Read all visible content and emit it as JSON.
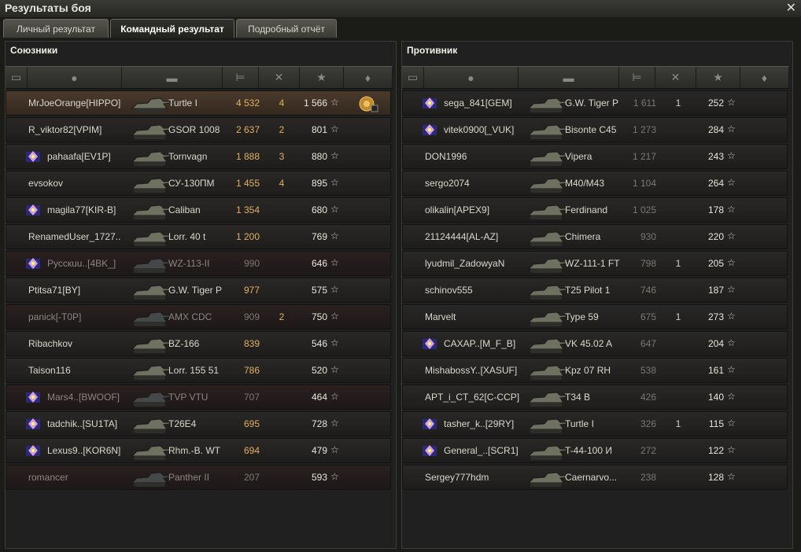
{
  "window": {
    "title": "Результаты боя"
  },
  "tabs": [
    {
      "label": "Личный результат",
      "active": false
    },
    {
      "label": "Командный результат",
      "active": true
    },
    {
      "label": "Подробный отчёт",
      "active": false
    }
  ],
  "headers": {
    "icons": [
      "platoon-icon",
      "player-icon",
      "tank-icon",
      "damage-icon",
      "frags-icon",
      "xp-icon",
      "medal-icon"
    ]
  },
  "allies": {
    "title": "Союзники",
    "rows": [
      {
        "name": "MrJoeOrange[HIPPO]",
        "badge": false,
        "vehicle": "Turtle I",
        "damage": "4 532",
        "frags": "4",
        "xp": "1 566",
        "medal": true,
        "style": "first"
      },
      {
        "name": "R_viktor82[VPIM]",
        "badge": false,
        "vehicle": "GSOR 1008",
        "damage": "2 637",
        "frags": "2",
        "xp": "801",
        "medal": false,
        "style": ""
      },
      {
        "name": "pahaafa[EV1P]",
        "badge": true,
        "vehicle": "Tornvagn",
        "damage": "1 888",
        "frags": "3",
        "xp": "880",
        "medal": false,
        "style": ""
      },
      {
        "name": "evsokov",
        "badge": false,
        "vehicle": "СУ-130ПМ",
        "damage": "1 455",
        "frags": "4",
        "xp": "895",
        "medal": false,
        "style": ""
      },
      {
        "name": "magila77[KIR-B]",
        "badge": true,
        "vehicle": "Caliban",
        "damage": "1 354",
        "frags": "",
        "xp": "680",
        "medal": false,
        "style": ""
      },
      {
        "name": "RenamedUser_1727..",
        "badge": false,
        "vehicle": "Lorr. 40 t",
        "damage": "1 200",
        "frags": "",
        "xp": "769",
        "medal": false,
        "style": ""
      },
      {
        "name": "Pусскuu..[4BK_]",
        "badge": true,
        "vehicle": "WZ-113-II",
        "damage": "990",
        "frags": "",
        "xp": "646",
        "medal": false,
        "style": "dead"
      },
      {
        "name": "Ptitsa71[BY]",
        "badge": false,
        "vehicle": "G.W. Tiger P",
        "damage": "977",
        "frags": "",
        "xp": "575",
        "medal": false,
        "style": ""
      },
      {
        "name": "panick[-T0P]",
        "badge": false,
        "vehicle": "AMX CDC",
        "damage": "909",
        "frags": "2",
        "xp": "750",
        "medal": false,
        "style": "dead"
      },
      {
        "name": "Ribachkov",
        "badge": false,
        "vehicle": "BZ-166",
        "damage": "839",
        "frags": "",
        "xp": "546",
        "medal": false,
        "style": ""
      },
      {
        "name": "Taison116",
        "badge": false,
        "vehicle": "Lorr. 155 51",
        "damage": "786",
        "frags": "",
        "xp": "520",
        "medal": false,
        "style": ""
      },
      {
        "name": "Mars4..[BWOOF]",
        "badge": true,
        "vehicle": "TVP VTU",
        "damage": "707",
        "frags": "",
        "xp": "464",
        "medal": false,
        "style": "dead"
      },
      {
        "name": "tadchik..[SU1TA]",
        "badge": true,
        "vehicle": "T26E4",
        "damage": "695",
        "frags": "",
        "xp": "728",
        "medal": false,
        "style": ""
      },
      {
        "name": "Lexus9..[KOR6N]",
        "badge": true,
        "vehicle": "Rhm.-B. WT",
        "damage": "694",
        "frags": "",
        "xp": "479",
        "medal": false,
        "style": ""
      },
      {
        "name": "romancer",
        "badge": false,
        "vehicle": "Panther II",
        "damage": "207",
        "frags": "",
        "xp": "593",
        "medal": false,
        "style": "dead"
      }
    ]
  },
  "enemies": {
    "title": "Противник",
    "rows": [
      {
        "name": "sega_841[GEM]",
        "badge": true,
        "vehicle": "G.W. Tiger P",
        "damage": "1 611",
        "frags": "1",
        "xp": "252",
        "medal": false,
        "style": ""
      },
      {
        "name": "vitek0900[_VUK]",
        "badge": true,
        "vehicle": "Bisonte C45",
        "damage": "1 273",
        "frags": "",
        "xp": "284",
        "medal": false,
        "style": ""
      },
      {
        "name": "DON1996",
        "badge": false,
        "vehicle": "Vipera",
        "damage": "1 217",
        "frags": "",
        "xp": "243",
        "medal": false,
        "style": ""
      },
      {
        "name": "sergo2074",
        "badge": false,
        "vehicle": "M40/M43",
        "damage": "1 104",
        "frags": "",
        "xp": "264",
        "medal": false,
        "style": ""
      },
      {
        "name": "olikalin[APEX9]",
        "badge": false,
        "vehicle": "Ferdinand",
        "damage": "1 025",
        "frags": "",
        "xp": "178",
        "medal": false,
        "style": ""
      },
      {
        "name": "21124444[AL-AZ]",
        "badge": false,
        "vehicle": "Chimera",
        "damage": "930",
        "frags": "",
        "xp": "220",
        "medal": false,
        "style": ""
      },
      {
        "name": "lyudmil_ZadowyaN",
        "badge": false,
        "vehicle": "WZ-111-1 FT",
        "damage": "798",
        "frags": "1",
        "xp": "205",
        "medal": false,
        "style": ""
      },
      {
        "name": "schinov555",
        "badge": false,
        "vehicle": "T25 Pilot 1",
        "damage": "746",
        "frags": "",
        "xp": "187",
        "medal": false,
        "style": ""
      },
      {
        "name": "Marvelt",
        "badge": false,
        "vehicle": "Type 59",
        "damage": "675",
        "frags": "1",
        "xp": "273",
        "medal": false,
        "style": ""
      },
      {
        "name": "CAXAP..[M_F_B]",
        "badge": true,
        "vehicle": "VK 45.02 A",
        "damage": "647",
        "frags": "",
        "xp": "204",
        "medal": false,
        "style": ""
      },
      {
        "name": "MishabossY..[XASUF]",
        "badge": false,
        "vehicle": "Kpz 07 RH",
        "damage": "538",
        "frags": "",
        "xp": "161",
        "medal": false,
        "style": ""
      },
      {
        "name": "APT_i_CT_62[C-CCP]",
        "badge": false,
        "vehicle": "T34 B",
        "damage": "426",
        "frags": "",
        "xp": "140",
        "medal": false,
        "style": ""
      },
      {
        "name": "tasher_k..[29RY]",
        "badge": true,
        "vehicle": "Turtle I",
        "damage": "326",
        "frags": "1",
        "xp": "115",
        "medal": false,
        "style": ""
      },
      {
        "name": "General_..[SCR1]",
        "badge": true,
        "vehicle": "T-44-100 И",
        "damage": "272",
        "frags": "",
        "xp": "122",
        "medal": false,
        "style": ""
      },
      {
        "name": "Sergey777hdm",
        "badge": false,
        "vehicle": "Caernarvo...",
        "damage": "238",
        "frags": "",
        "xp": "128",
        "medal": false,
        "style": ""
      }
    ]
  },
  "symbols": {
    "star": "☆",
    "close": "✕"
  },
  "colors": {
    "damage": "#e0b060",
    "title": "#e6e6dc"
  }
}
